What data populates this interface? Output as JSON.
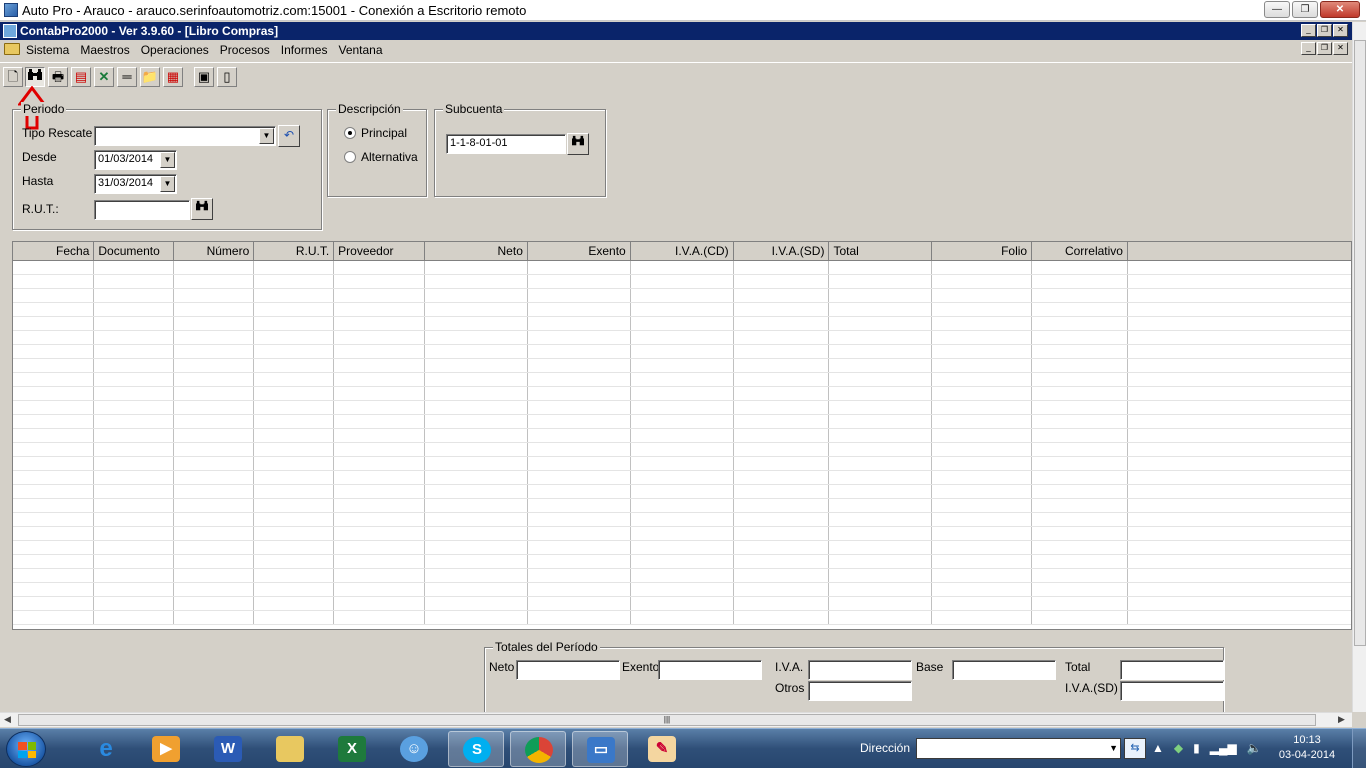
{
  "rdp_window": {
    "title": "Auto Pro - Arauco - arauco.serinfoautomotriz.com:15001 - Conexión a Escritorio remoto",
    "minimize": "—",
    "restore": "❐",
    "close": "✕"
  },
  "app": {
    "title": "ContabPro2000 - Ver 3.9.60 - [Libro Compras]",
    "menu": [
      "Sistema",
      "Maestros",
      "Operaciones",
      "Procesos",
      "Informes",
      "Ventana"
    ]
  },
  "toolbar": {
    "icons": [
      "new-icon",
      "binoculars-icon",
      "print-icon",
      "print-preview-icon",
      "excel-export-icon",
      "equals-icon",
      "folder-icon",
      "grid-icon",
      "properties-icon",
      "document-icon"
    ],
    "glyphs": [
      "🗋",
      "⛓",
      "🖶",
      "▤",
      "✕",
      "═",
      "📁",
      "▦",
      "▣",
      "▯"
    ],
    "highlight_color": "#e00000"
  },
  "periodo": {
    "legend": "Periodo",
    "tipo_rescate_label": "Tipo Rescate",
    "tipo_rescate_value": "",
    "desde_label": "Desde",
    "desde_value": "01/03/2014",
    "hasta_label": "Hasta",
    "hasta_value": "31/03/2014",
    "rut_label": "R.U.T.:",
    "rut_value": ""
  },
  "descripcion": {
    "legend": "Descripción",
    "options": [
      "Principal",
      "Alternativa"
    ],
    "selected": "Principal"
  },
  "subcuenta": {
    "legend": "Subcuenta",
    "value": "1-1-8-01-01"
  },
  "grid": {
    "columns": [
      "Fecha",
      "Documento",
      "Número",
      "R.U.T.",
      "Proveedor",
      "Neto",
      "Exento",
      "I.V.A.(CD)",
      "I.V.A.(SD)",
      "Total",
      "Folio",
      "Correlativo"
    ],
    "rows": []
  },
  "totales": {
    "legend": "Totales del Período",
    "neto_label": "Neto",
    "exento_label": "Exento",
    "iva_label": "I.V.A.",
    "otros_label": "Otros",
    "base_label": "Base",
    "total_label": "Total",
    "iva_sd_label": "I.V.A.(SD)",
    "neto_value": "",
    "exento_value": "",
    "iva_value": "",
    "otros_value": "",
    "base_value": "",
    "total_value": "",
    "iva_sd_value": ""
  },
  "taskbar": {
    "apps": [
      "internet-explorer",
      "media-player",
      "word",
      "file-explorer",
      "excel",
      "messenger",
      "skype",
      "chrome",
      "remote-desktop",
      "paint"
    ],
    "active_app": "remote-desktop",
    "direccion_label": "Dirección",
    "direccion_value": "",
    "time": "10:13",
    "date": "03-04-2014"
  }
}
